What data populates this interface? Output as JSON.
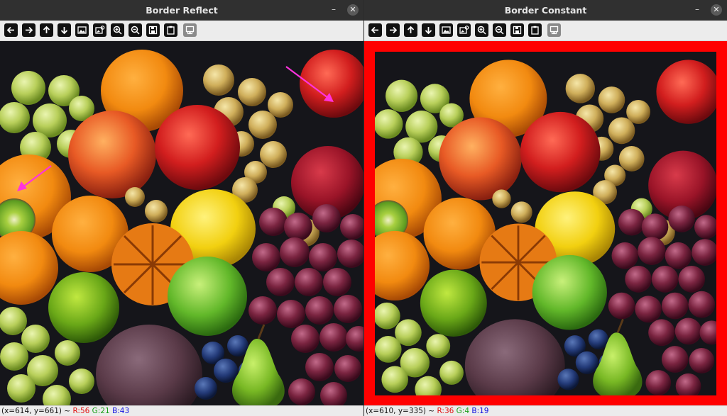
{
  "windows": [
    {
      "title": "Border Reflect",
      "status": {
        "coords": "(x=614, y=661) ~ ",
        "r": "R:56",
        "g": "G:21",
        "b": "B:43"
      }
    },
    {
      "title": "Border Constant",
      "status": {
        "coords": "(x=610, y=335) ~ ",
        "r": "R:36",
        "g": "G:4",
        "b": "B:19"
      }
    }
  ],
  "toolbar_icons": [
    "arrow-left-icon",
    "arrow-right-icon",
    "arrow-up-icon",
    "arrow-down-icon",
    "image-icon",
    "image-settings-icon",
    "zoom-in-icon",
    "zoom-out-icon",
    "save-icon",
    "clipboard-icon",
    "properties-icon"
  ],
  "colors": {
    "border_constant": "#ff0000",
    "annotation_arrow": "#ff33dd",
    "status_r": "#e01010",
    "status_g": "#18a018",
    "status_b": "#1010e0"
  },
  "window_controls": {
    "minimize": "–",
    "close": "✕"
  }
}
